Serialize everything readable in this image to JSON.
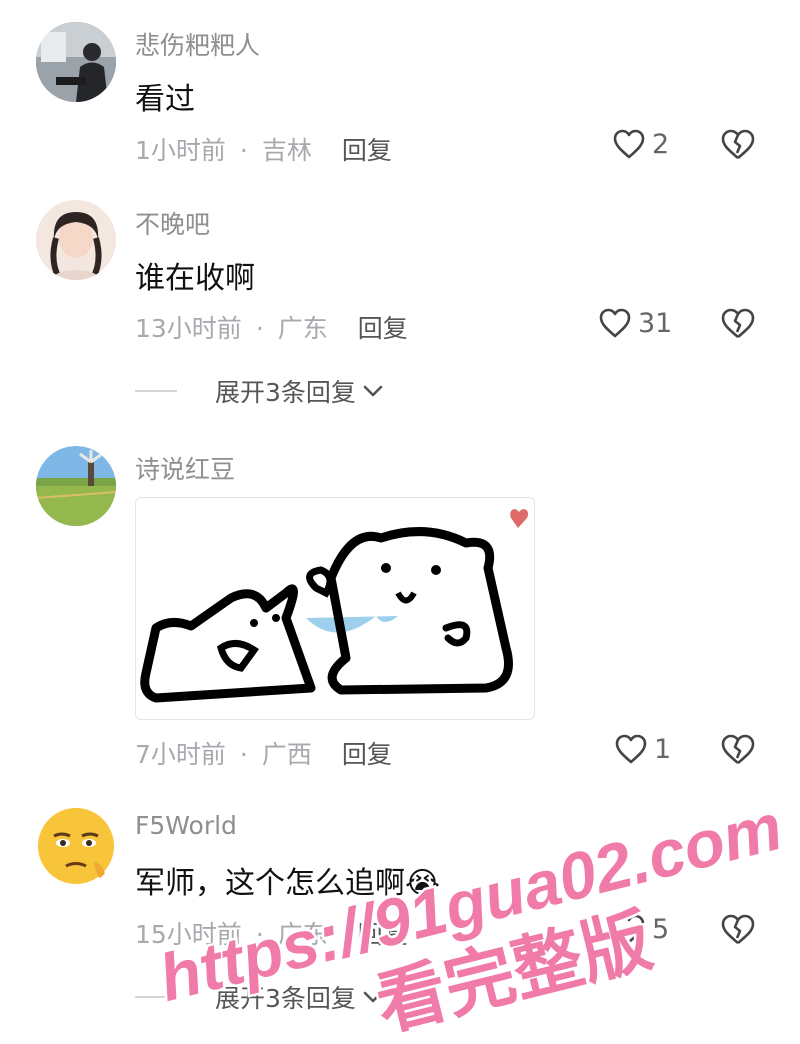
{
  "comments": [
    {
      "username": "悲伤粑粑人",
      "text": "看过",
      "time": "1小时前",
      "location": "吉林",
      "reply_label": "回复",
      "likes": "2"
    },
    {
      "username": "不晚吧",
      "text": "谁在收啊",
      "time": "13小时前",
      "location": "广东",
      "reply_label": "回复",
      "likes": "31",
      "expand_label": "展开3条回复"
    },
    {
      "username": "诗说红豆",
      "text": "",
      "time": "7小时前",
      "location": "广西",
      "reply_label": "回复",
      "likes": "1"
    },
    {
      "username": "F5World",
      "text": "军师，这个怎么追啊😭",
      "time": "15小时前",
      "location": "广东",
      "reply_label": "回复",
      "likes": "5",
      "expand_label": "展开3条回复"
    }
  ],
  "separator": "·",
  "watermark": {
    "line1": "https://91gua02.com",
    "line2": "看完整版",
    "color": "#f07aa8"
  },
  "icons": [
    "heart-icon",
    "broken-heart-icon",
    "chevron-down-icon"
  ]
}
